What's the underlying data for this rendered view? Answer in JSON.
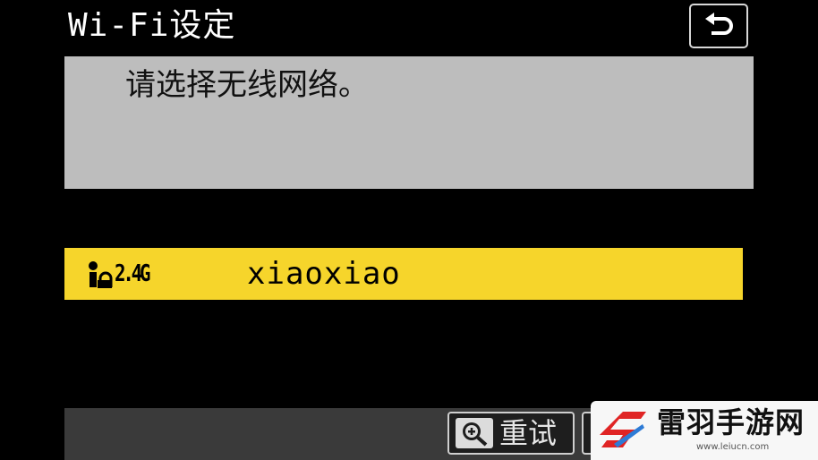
{
  "header": {
    "title": "Wi-Fi设定",
    "back_icon": "return-arrow-icon"
  },
  "message": {
    "text": "请选择无线网络。"
  },
  "networks": [
    {
      "band": "2.4G",
      "ssid": "xiaoxiao",
      "selected": true,
      "icon": "wifi-signal-icon"
    }
  ],
  "footer": {
    "retry_label": "重试",
    "retry_icon": "zoom-in-icon"
  },
  "watermark": {
    "name": "雷羽手游网",
    "url": "www.leiucn.com"
  },
  "colors": {
    "highlight": "#f6d52b",
    "panel": "#bdbdbd",
    "footer": "#3a3a3a",
    "watermark_red": "#e02424"
  }
}
